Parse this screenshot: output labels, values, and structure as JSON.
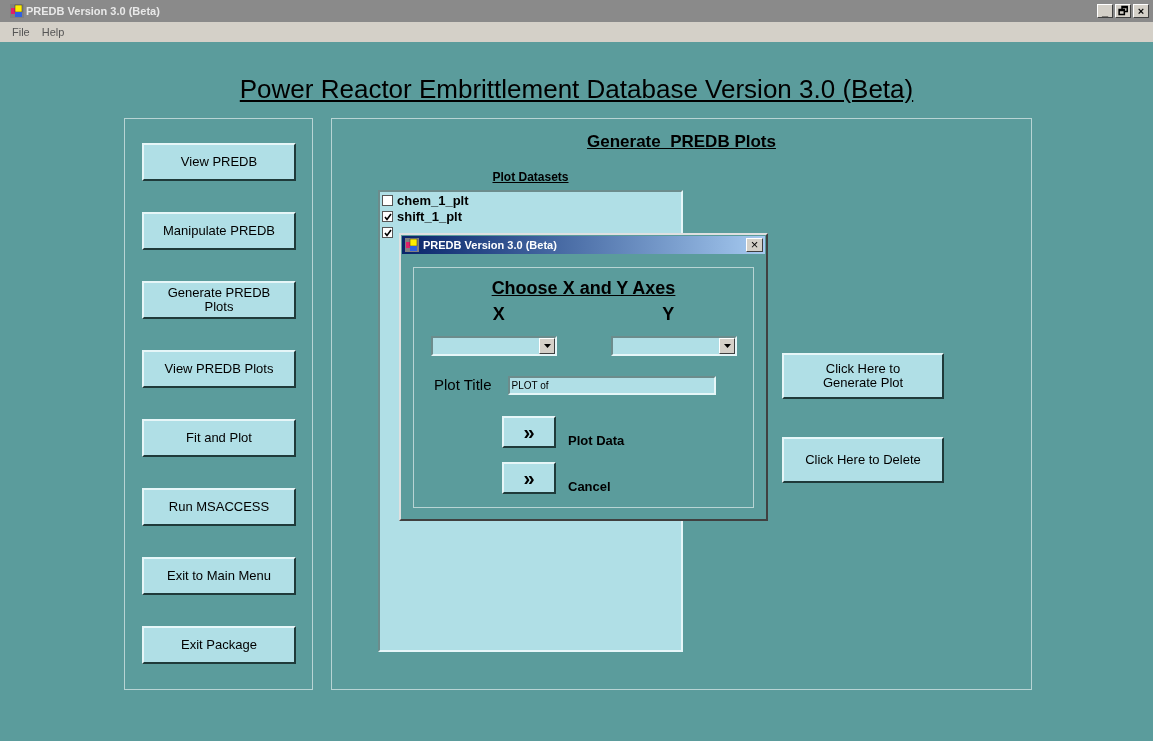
{
  "window": {
    "title": "PREDB Version 3.0 (Beta)",
    "controls": [
      "_",
      "🗗",
      "×"
    ]
  },
  "menu": [
    "File",
    "Help"
  ],
  "heading": "Power Reactor Embrittlement Database Version 3.0 (Beta)",
  "nav_buttons": [
    "View PREDB",
    "Manipulate PREDB",
    "Generate PREDB Plots",
    "View PREDB Plots",
    "Fit and Plot",
    "Run MSACCESS",
    "Exit to Main Menu",
    "Exit Package"
  ],
  "panel": {
    "title": "Generate  PREDB Plots",
    "list_label": "Plot Datasets",
    "datasets": [
      {
        "label": "chem_1_plt",
        "checked": false
      },
      {
        "label": "shift_1_plt",
        "checked": true
      },
      {
        "checked": true
      }
    ],
    "actions": [
      "Click Here to Generate Plot",
      "Click Here to Delete"
    ]
  },
  "dialog": {
    "title": "PREDB Version 3.0 (Beta)",
    "close": "×",
    "heading": "Choose X and Y Axes",
    "x_label": "X",
    "y_label": "Y",
    "plot_title_label": "Plot Title",
    "plot_title_value": "PLOT of",
    "buttons": [
      {
        "glyph": "»",
        "label": "Plot Data"
      },
      {
        "glyph": "»",
        "label": "Cancel"
      }
    ]
  }
}
